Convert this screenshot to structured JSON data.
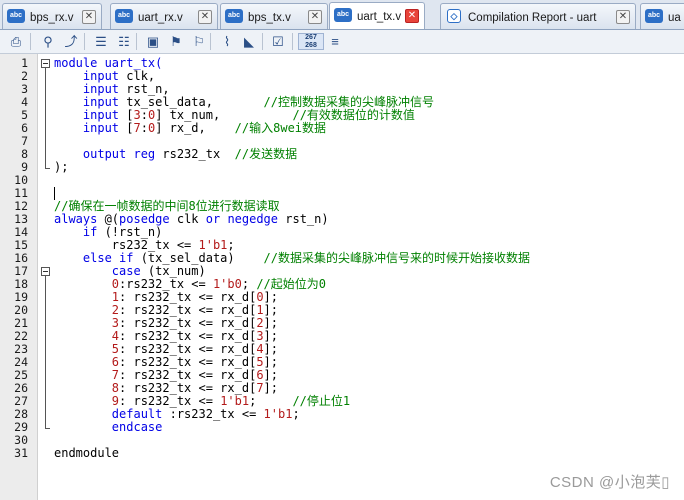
{
  "tabs": [
    {
      "label": "bps_rx.v",
      "icon": "verilog-file-icon",
      "icon_text": "abc",
      "active": false
    },
    {
      "label": "uart_rx.v",
      "icon": "verilog-file-icon",
      "icon_text": "abc",
      "active": false
    },
    {
      "label": "bps_tx.v",
      "icon": "verilog-file-icon",
      "icon_text": "abc",
      "active": false
    },
    {
      "label": "uart_tx.v",
      "icon": "verilog-file-icon",
      "icon_text": "abc",
      "active": true
    },
    {
      "label": "Compilation Report - uart",
      "icon": "report-icon",
      "icon_text": "◇",
      "active": false
    },
    {
      "label": "ua",
      "icon": "verilog-file-icon",
      "icon_text": "abc",
      "active": false
    }
  ],
  "toolbar": {
    "buttons": [
      "print-icon",
      "find-icon",
      "find-next-icon",
      "indent-icon",
      "unindent-icon",
      "insert-template-icon",
      "toggle-bookmark-icon",
      "next-bookmark-icon",
      "attach-icon",
      "comment-icon",
      "check-syntax-icon",
      "line-counter-icon",
      "list-icon"
    ],
    "counter_top": "267",
    "counter_bottom": "268"
  },
  "editor": {
    "lines": [
      [
        {
          "t": "module uart_tx(",
          "s": "k"
        }
      ],
      [
        {
          "t": "    ",
          "s": ""
        },
        {
          "t": "input",
          "s": "k"
        },
        {
          "t": " clk,",
          "s": ""
        }
      ],
      [
        {
          "t": "    ",
          "s": ""
        },
        {
          "t": "input",
          "s": "k"
        },
        {
          "t": " rst_n,",
          "s": ""
        }
      ],
      [
        {
          "t": "    ",
          "s": ""
        },
        {
          "t": "input",
          "s": "k"
        },
        {
          "t": " tx_sel_data,       ",
          "s": ""
        },
        {
          "t": "//控制数据采集的尖峰脉冲信号",
          "s": "c"
        }
      ],
      [
        {
          "t": "    ",
          "s": ""
        },
        {
          "t": "input",
          "s": "k"
        },
        {
          "t": " [",
          "s": ""
        },
        {
          "t": "3",
          "s": "n"
        },
        {
          "t": ":",
          "s": ""
        },
        {
          "t": "0",
          "s": "n"
        },
        {
          "t": "] tx_num,          ",
          "s": ""
        },
        {
          "t": "//有效数据位的计数值",
          "s": "c"
        }
      ],
      [
        {
          "t": "    ",
          "s": ""
        },
        {
          "t": "input",
          "s": "k"
        },
        {
          "t": " [",
          "s": ""
        },
        {
          "t": "7",
          "s": "n"
        },
        {
          "t": ":",
          "s": ""
        },
        {
          "t": "0",
          "s": "n"
        },
        {
          "t": "] rx_d,    ",
          "s": ""
        },
        {
          "t": "//输入8wei数据",
          "s": "c"
        }
      ],
      [],
      [
        {
          "t": "    ",
          "s": ""
        },
        {
          "t": "output reg",
          "s": "k"
        },
        {
          "t": " rs232_tx  ",
          "s": ""
        },
        {
          "t": "//发送数据",
          "s": "c"
        }
      ],
      [
        {
          "t": ");",
          "s": ""
        }
      ],
      [],
      [],
      [
        {
          "t": "//确保在一帧数据的中间8位进行数据读取",
          "s": "c"
        }
      ],
      [
        {
          "t": "always",
          "s": "k"
        },
        {
          "t": " @(",
          "s": ""
        },
        {
          "t": "posedge",
          "s": "k"
        },
        {
          "t": " clk ",
          "s": ""
        },
        {
          "t": "or",
          "s": "k"
        },
        {
          "t": " ",
          "s": ""
        },
        {
          "t": "negedge",
          "s": "k"
        },
        {
          "t": " rst_n)",
          "s": ""
        }
      ],
      [
        {
          "t": "    ",
          "s": ""
        },
        {
          "t": "if",
          "s": "k"
        },
        {
          "t": " (!rst_n)",
          "s": ""
        }
      ],
      [
        {
          "t": "        rs232_tx <= ",
          "s": ""
        },
        {
          "t": "1'b1",
          "s": "n"
        },
        {
          "t": ";",
          "s": ""
        }
      ],
      [
        {
          "t": "    ",
          "s": ""
        },
        {
          "t": "else if",
          "s": "k"
        },
        {
          "t": " (tx_sel_data)    ",
          "s": ""
        },
        {
          "t": "//数据采集的尖峰脉冲信号来的时候开始接收数据",
          "s": "c"
        }
      ],
      [
        {
          "t": "        ",
          "s": ""
        },
        {
          "t": "case",
          "s": "k"
        },
        {
          "t": " (tx_num)",
          "s": ""
        }
      ],
      [
        {
          "t": "        ",
          "s": ""
        },
        {
          "t": "0",
          "s": "n"
        },
        {
          "t": ":rs232_tx <= ",
          "s": ""
        },
        {
          "t": "1'b0",
          "s": "n"
        },
        {
          "t": "; ",
          "s": ""
        },
        {
          "t": "//起始位为0",
          "s": "c"
        }
      ],
      [
        {
          "t": "        ",
          "s": ""
        },
        {
          "t": "1",
          "s": "n"
        },
        {
          "t": ": rs232_tx <= rx_d[",
          "s": ""
        },
        {
          "t": "0",
          "s": "n"
        },
        {
          "t": "];",
          "s": ""
        }
      ],
      [
        {
          "t": "        ",
          "s": ""
        },
        {
          "t": "2",
          "s": "n"
        },
        {
          "t": ": rs232_tx <= rx_d[",
          "s": ""
        },
        {
          "t": "1",
          "s": "n"
        },
        {
          "t": "];",
          "s": ""
        }
      ],
      [
        {
          "t": "        ",
          "s": ""
        },
        {
          "t": "3",
          "s": "n"
        },
        {
          "t": ": rs232_tx <= rx_d[",
          "s": ""
        },
        {
          "t": "2",
          "s": "n"
        },
        {
          "t": "];",
          "s": ""
        }
      ],
      [
        {
          "t": "        ",
          "s": ""
        },
        {
          "t": "4",
          "s": "n"
        },
        {
          "t": ": rs232_tx <= rx_d[",
          "s": ""
        },
        {
          "t": "3",
          "s": "n"
        },
        {
          "t": "];",
          "s": ""
        }
      ],
      [
        {
          "t": "        ",
          "s": ""
        },
        {
          "t": "5",
          "s": "n"
        },
        {
          "t": ": rs232_tx <= rx_d[",
          "s": ""
        },
        {
          "t": "4",
          "s": "n"
        },
        {
          "t": "];",
          "s": ""
        }
      ],
      [
        {
          "t": "        ",
          "s": ""
        },
        {
          "t": "6",
          "s": "n"
        },
        {
          "t": ": rs232_tx <= rx_d[",
          "s": ""
        },
        {
          "t": "5",
          "s": "n"
        },
        {
          "t": "];",
          "s": ""
        }
      ],
      [
        {
          "t": "        ",
          "s": ""
        },
        {
          "t": "7",
          "s": "n"
        },
        {
          "t": ": rs232_tx <= rx_d[",
          "s": ""
        },
        {
          "t": "6",
          "s": "n"
        },
        {
          "t": "];",
          "s": ""
        }
      ],
      [
        {
          "t": "        ",
          "s": ""
        },
        {
          "t": "8",
          "s": "n"
        },
        {
          "t": ": rs232_tx <= rx_d[",
          "s": ""
        },
        {
          "t": "7",
          "s": "n"
        },
        {
          "t": "];",
          "s": ""
        }
      ],
      [
        {
          "t": "        ",
          "s": ""
        },
        {
          "t": "9",
          "s": "n"
        },
        {
          "t": ": rs232_tx <= ",
          "s": ""
        },
        {
          "t": "1'b1",
          "s": "n"
        },
        {
          "t": ";     ",
          "s": ""
        },
        {
          "t": "//停止位1",
          "s": "c"
        }
      ],
      [
        {
          "t": "        ",
          "s": ""
        },
        {
          "t": "default",
          "s": "k"
        },
        {
          "t": " :rs232_tx <= ",
          "s": ""
        },
        {
          "t": "1'b1",
          "s": "n"
        },
        {
          "t": ";",
          "s": ""
        }
      ],
      [
        {
          "t": "        ",
          "s": ""
        },
        {
          "t": "endcase",
          "s": "k"
        }
      ],
      [],
      [
        {
          "t": "endmodule",
          "s": ""
        }
      ]
    ]
  },
  "watermark": "CSDN @小泡芙▯"
}
